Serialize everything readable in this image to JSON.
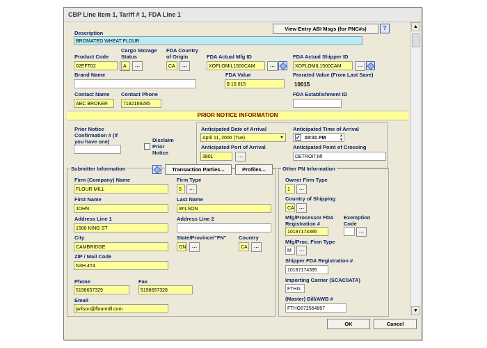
{
  "window": {
    "title": "CBP Line Item 1, Tariff # 1, FDA Line 1"
  },
  "toolbar": {
    "view_abi": "View Entry ABI Msgs (for PNC#s)",
    "help_icon": "?"
  },
  "description": {
    "label": "Description",
    "value": "BROMATED WHEAT FLOUR"
  },
  "product_code": {
    "label": "Product Code",
    "value": "02EFT02"
  },
  "cargo_storage": {
    "label": "Cargo Storage Status",
    "value": "A"
  },
  "fda_country_origin": {
    "label": "FDA Country of Origin",
    "value": "CA"
  },
  "fda_mfg_id": {
    "label": "FDA Actual Mfg ID",
    "value": "XOFLOMIL1500CAM"
  },
  "fda_shipper_id": {
    "label": "FDA Actual Shipper ID",
    "value": "XOFLOMIL1500CAM"
  },
  "brand_name": {
    "label": "Brand Name",
    "value": ""
  },
  "fda_value": {
    "label": "FDA Value",
    "value": "$ 10,015"
  },
  "prorated_value": {
    "label": "Prorated Value (From Last Save)",
    "value": "10015"
  },
  "contact_name": {
    "label": "Contact Name",
    "value": "ABC BROKER"
  },
  "contact_phone": {
    "label": "Contact Phone",
    "value": "7182169285"
  },
  "fda_establishment": {
    "label": "FDA Establishment ID",
    "value": ""
  },
  "prior_notice": {
    "band": "PRIOR NOTICE INFORMATION",
    "confirmation_label": "Prior Notice Confirmation # (if you have one)",
    "confirmation_value": "",
    "disclaim_label": "Disclaim Prior Notice",
    "arrival_date_label": "Anticipated Date of Arrival",
    "arrival_date_value": "April 11, 2006 (Tue)",
    "arrival_time_label": "Anticipated Time of Arrival",
    "arrival_time_value": "03:31 PM",
    "arrival_time_check": "✓",
    "port_label": "Anticipated Port of Arrival",
    "port_value": "3801",
    "crossing_label": "Anticipated Point of Crossing",
    "crossing_value": "DETROIT,MI"
  },
  "submitter": {
    "title": "Submitter Information",
    "transaction_btn": "Transaction Parties...",
    "profiles_btn": "Profiles...",
    "firm_name_label": "Firm (Company) Name",
    "firm_name_value": "FLOUR MILL",
    "firm_type_label": "Firm Type",
    "firm_type_value": "5",
    "first_name_label": "First Name",
    "first_name_value": "JOHN",
    "last_name_label": "Last Name",
    "last_name_value": "WILSON",
    "addr1_label": "Address Line 1",
    "addr1_value": "1500 KING ST",
    "addr2_label": "Address Line 2",
    "addr2_value": "",
    "city_label": "City",
    "city_value": "CAMBRIDGE",
    "state_label": "State/Province/\"FN\"",
    "state_value": "ON",
    "country_label": "Country",
    "country_value": "CA",
    "zip_label": "ZIP / Mail Code",
    "zip_value": "N3H 4T4",
    "phone_label": "Phone",
    "phone_value": "5198657329",
    "fax_label": "Fax",
    "fax_value": "5198657328",
    "email_label": "Email",
    "email_value": "jwilson@flourmill.com"
  },
  "other_pn": {
    "title": "Other PN Information",
    "owner_label": "Owner Firm Type",
    "owner_value": "1",
    "shipping_label": "Country of Shipping",
    "shipping_value": "CA",
    "mfg_reg_label": "Mfg/Processor FDA Registration #",
    "mfg_reg_value": "10187174395",
    "exemption_label": "Exemption Code",
    "exemption_value": "",
    "mfg_type_label": "Mfg/Proc. Firm Type",
    "mfg_type_value": "M",
    "shipper_reg_label": "Shipper FDA Registration #",
    "shipper_reg_value": "10187174395",
    "carrier_label": "Importing Carrier (SCAC/IATA)",
    "carrier_value": "FTHG",
    "bill_label": "(Master) Bill/AWB #",
    "bill_value": "FTHG672564867"
  },
  "buttons": {
    "ok": "OK",
    "cancel": "Cancel",
    "ellipsis": "..."
  },
  "colors": {
    "required": "#ffff99",
    "description": "#b8ecf6",
    "label": "#0a246a"
  }
}
